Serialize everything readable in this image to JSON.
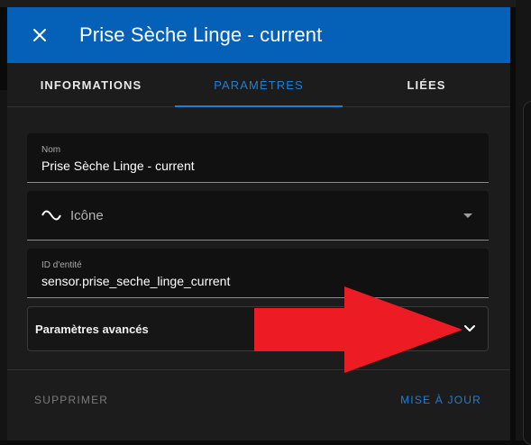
{
  "dialog": {
    "title": "Prise Sèche Linge - current",
    "close_icon": "close-icon",
    "header_color": "#0461b7",
    "accent_color": "#1c7fd6"
  },
  "tabs": [
    {
      "label": "INFORMATIONS",
      "active": false
    },
    {
      "label": "PARAMÈTRES",
      "active": true
    },
    {
      "label": "LIÉES",
      "active": false
    }
  ],
  "fields": {
    "name": {
      "label": "Nom",
      "value": "Prise Sèche Linge - current"
    },
    "icon": {
      "placeholder": "Icône",
      "icon": "sine-wave-icon"
    },
    "entity_id": {
      "label": "ID d'entité",
      "value": "sensor.prise_seche_linge_current"
    }
  },
  "advanced": {
    "label": "Paramètres avancés",
    "expanded": false
  },
  "actions": {
    "delete": "SUPPRIMER",
    "update": "MISE À JOUR"
  },
  "annotation": {
    "arrow_color": "#ed1c24"
  }
}
